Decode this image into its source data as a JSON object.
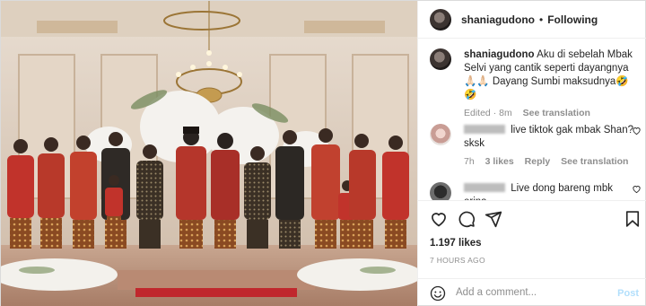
{
  "colors": {
    "accent": "#0095f6",
    "muted": "#8e8e8e",
    "border": "#efefef"
  },
  "header": {
    "username": "shaniagudono",
    "separator": "•",
    "follow_status": "Following"
  },
  "caption": {
    "username": "shaniagudono",
    "text": "Aku di sebelah Mbak Selvi yang cantik seperti dayangnya 🙏🏻🙏🏻 Dayang Sumbi maksudnya🤣🤣",
    "edited": "Edited · 8m",
    "see_translation": "See translation"
  },
  "comments": [
    {
      "text": "live tiktok gak mbak Shan? sksk",
      "time": "7h",
      "likes": "3 likes",
      "reply": "Reply",
      "see_translation": "See translation"
    },
    {
      "text": "Live dong bareng mbk erina"
    }
  ],
  "actions": {
    "icons": [
      "heart-icon",
      "comment-icon",
      "share-icon",
      "bookmark-icon"
    ]
  },
  "likes": "1.197 likes",
  "posted_time": "7 HOURS AGO",
  "add_comment": {
    "placeholder": "Add a comment...",
    "post_label": "Post"
  }
}
